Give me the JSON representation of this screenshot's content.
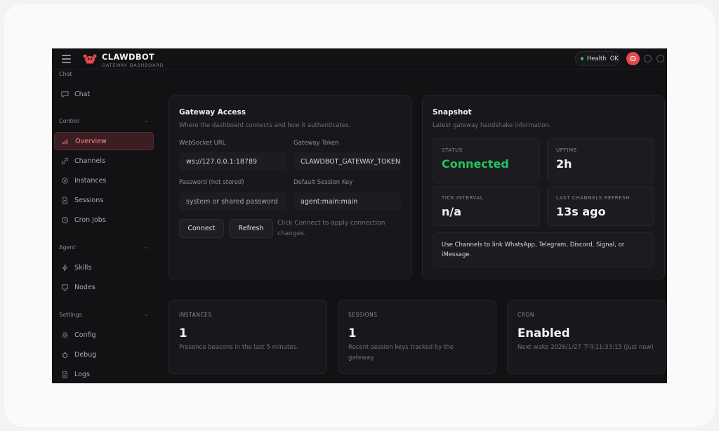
{
  "app": {
    "title": "CLAWDBOT",
    "subtitle": "GATEWAY DASHBOARD"
  },
  "topbar": {
    "health_label": "Health",
    "health_value": "OK",
    "status_color": "#22c55e",
    "accent": "#e04b4b"
  },
  "sidebar": {
    "groups": [
      {
        "label": "Chat",
        "items": [
          {
            "label": "Chat",
            "icon": "chat-bubble-icon"
          }
        ]
      },
      {
        "label": "Control",
        "items": [
          {
            "label": "Overview",
            "icon": "bar-chart-icon",
            "active": true
          },
          {
            "label": "Channels",
            "icon": "link-icon"
          },
          {
            "label": "Instances",
            "icon": "radio-icon"
          },
          {
            "label": "Sessions",
            "icon": "document-icon"
          },
          {
            "label": "Cron Jobs",
            "icon": "clock-icon"
          }
        ]
      },
      {
        "label": "Agent",
        "items": [
          {
            "label": "Skills",
            "icon": "lightning-icon"
          },
          {
            "label": "Nodes",
            "icon": "monitor-icon"
          }
        ]
      },
      {
        "label": "Settings",
        "items": [
          {
            "label": "Config",
            "icon": "gear-icon"
          },
          {
            "label": "Debug",
            "icon": "bug-icon"
          },
          {
            "label": "Logs",
            "icon": "file-text-icon"
          }
        ]
      }
    ]
  },
  "gateway": {
    "title": "Gateway Access",
    "subtitle": "Where the dashboard connects and how it authenticates.",
    "ws_label": "WebSocket URL",
    "ws_value": "ws://127.0.0.1:18789",
    "token_label": "Gateway Token",
    "token_value": "CLAWDBOT_GATEWAY_TOKEN",
    "password_label": "Password (not stored)",
    "password_placeholder": "system or shared password",
    "session_label": "Default Session Key",
    "session_value": "agent:main:main",
    "connect": "Connect",
    "refresh": "Refresh",
    "hint": "Click Connect to apply connection changes."
  },
  "snapshot": {
    "title": "Snapshot",
    "subtitle": "Latest gateway handshake information.",
    "status_label": "STATUS",
    "status_value": "Connected",
    "uptime_label": "UPTIME",
    "uptime_value": "2h",
    "tick_label": "TICK INTERVAL",
    "tick_value": "n/a",
    "refresh_label": "LAST CHANNELS REFRESH",
    "refresh_value": "13s ago",
    "note": "Use Channels to link WhatsApp, Telegram, Discord, Signal, or iMessage."
  },
  "metrics": [
    {
      "label": "INSTANCES",
      "value": "1",
      "desc": "Presence beacons in the last 5 minutes."
    },
    {
      "label": "SESSIONS",
      "value": "1",
      "desc": "Recent session keys tracked by the gateway."
    },
    {
      "label": "CRON",
      "value": "Enabled",
      "desc": "Next wake 2026/1/27 下午11:33:15 (just now)"
    }
  ]
}
